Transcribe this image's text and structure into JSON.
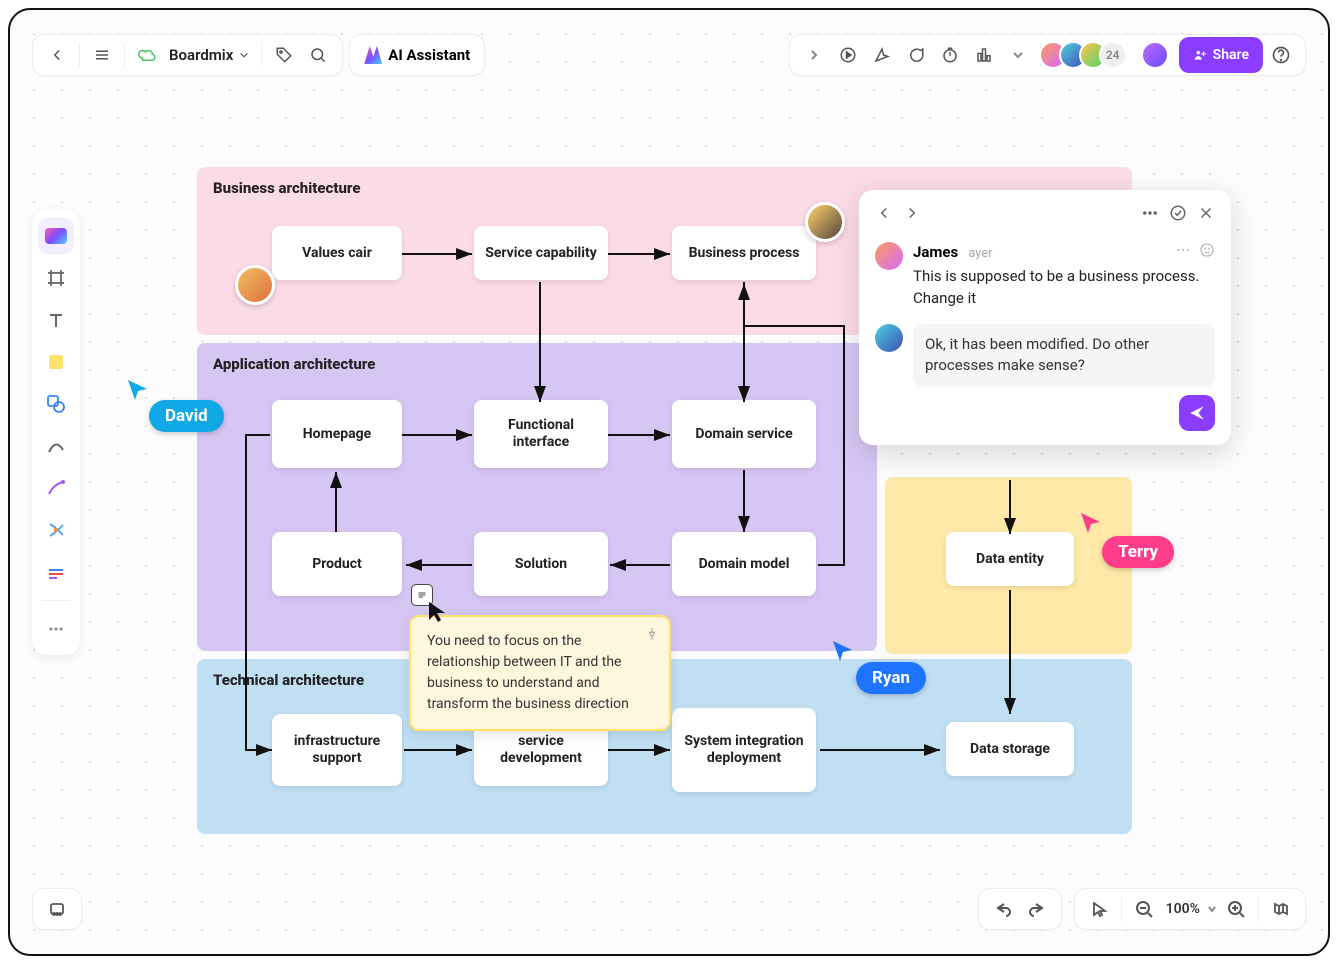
{
  "app": {
    "name": "Boardmix",
    "ai_label": "AI Assistant"
  },
  "toolbar": {
    "share_label": "Share",
    "avatar_overflow": "24"
  },
  "zoom": {
    "pct": "100%"
  },
  "lanes": {
    "business": "Business architecture",
    "application": "Application architecture",
    "technical": "Technical architecture"
  },
  "nodes": {
    "values": "Values cair",
    "service_cap": "Service capability",
    "biz_process": "Business process",
    "homepage": "Homepage",
    "func_iface": "Functional interface",
    "domain_svc": "Domain service",
    "product": "Product",
    "solution": "Solution",
    "domain_model": "Domain model",
    "data_entity": "Data entity",
    "infra": "infrastructure support",
    "svc_dev": "service development",
    "sys_int": "System integration deployment",
    "storage": "Data storage"
  },
  "sticky": {
    "text": "You need to focus on the relationship between IT and the business to understand and transform the business direction"
  },
  "cursors": {
    "david": "David",
    "ryan": "Ryan",
    "terry": "Terry"
  },
  "comments": {
    "author": "James",
    "time": "ayer",
    "text": "This is supposed to be a business process. Change it",
    "reply": "Ok, it has been modified. Do other processes make sense?"
  }
}
